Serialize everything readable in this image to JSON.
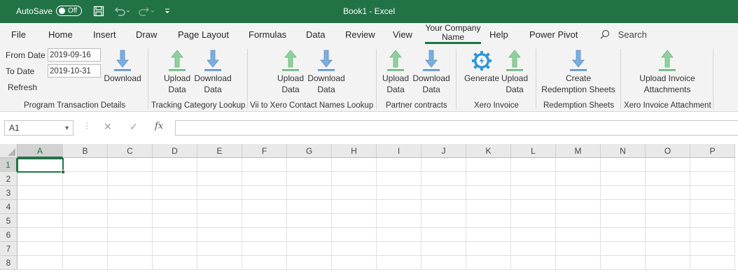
{
  "titlebar": {
    "autosave_label": "AutoSave",
    "autosave_state": "Off",
    "title": "Book1  -  Excel"
  },
  "tabs": [
    "File",
    "Home",
    "Insert",
    "Draw",
    "Page Layout",
    "Formulas",
    "Data",
    "Review",
    "View",
    "Your Company Name",
    "Help",
    "Power Pivot"
  ],
  "company_tab": {
    "line1": "Your Company",
    "line2": "Name"
  },
  "search": {
    "label": "Search"
  },
  "ribbon": {
    "program": {
      "from_label": "From Date",
      "from_value": "2019-09-16",
      "to_label": "To Date",
      "to_value": "2019-10-31",
      "refresh_label": "Refresh",
      "download_label": "Download",
      "group_label": "Program Transaction Details"
    },
    "tracking": {
      "upload_l1": "Upload",
      "upload_l2": "Data",
      "download_l1": "Download",
      "download_l2": "Data",
      "group_label": "Tracking Category Lookup"
    },
    "vii": {
      "upload_l1": "Upload",
      "upload_l2": "Data",
      "download_l1": "Download",
      "download_l2": "Data",
      "group_label": "Vii to Xero Contact Names Lookup"
    },
    "partner": {
      "upload_l1": "Upload",
      "upload_l2": "Data",
      "download_l1": "Download",
      "download_l2": "Data",
      "group_label": "Partner contracts"
    },
    "xero_invoice": {
      "generate_label": "Generate",
      "upload_l1": "Upload",
      "upload_l2": "Data",
      "group_label": "Xero Invoice"
    },
    "redemption": {
      "create_l1": "Create",
      "create_l2": "Redemption Sheets",
      "group_label": "Redemption Sheets"
    },
    "attachment": {
      "upload_l1": "Upload Invoice",
      "upload_l2": "Attachments",
      "group_label": "Xero Invoice Attachment"
    }
  },
  "formula_bar": {
    "name_box": "A1",
    "formula": ""
  },
  "grid": {
    "columns": [
      "A",
      "B",
      "C",
      "D",
      "E",
      "F",
      "G",
      "H",
      "I",
      "J",
      "K",
      "L",
      "M",
      "N",
      "O",
      "P"
    ],
    "rows": [
      "1",
      "2",
      "3",
      "4",
      "5",
      "6",
      "7",
      "8"
    ],
    "active_cell": "A1"
  },
  "colors": {
    "excel_green": "#217346",
    "upload_arrow": "#8fd19e",
    "download_arrow": "#7aaee0",
    "gear": "#2f97d6"
  },
  "icons": {
    "save": "save-icon",
    "undo": "undo-icon",
    "redo": "redo-icon",
    "customize": "customize-qat-icon",
    "search": "search-icon",
    "upload": "upload-arrow-icon",
    "download": "download-arrow-icon",
    "generate": "gear-lightning-icon",
    "create": "download-arrow-icon"
  }
}
